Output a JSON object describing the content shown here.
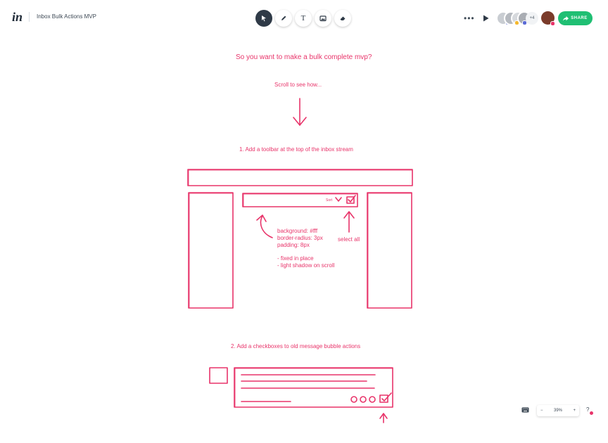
{
  "header": {
    "logo": "in",
    "title": "Inbox Bulk Actions MVP",
    "tools": [
      {
        "name": "select-tool",
        "icon": "cursor-icon",
        "active": true
      },
      {
        "name": "pen-tool",
        "icon": "pen-icon",
        "active": false
      },
      {
        "name": "text-tool",
        "icon": "text-icon",
        "label": "T",
        "active": false
      },
      {
        "name": "image-tool",
        "icon": "image-icon",
        "active": false
      },
      {
        "name": "eraser-tool",
        "icon": "eraser-icon",
        "active": false
      }
    ],
    "more_label": "•••",
    "collaborators_more": "+4",
    "share_label": "SHARE"
  },
  "canvas": {
    "heading": "So you want to make a bulk complete mvp?",
    "scroll_hint": "Scroll to see how...",
    "step1": "1. Add a toolbar at the top of the inbox stream",
    "sort_label": "Sort",
    "note_lines": [
      "background: #fff",
      "border-radius: 3px",
      "padding: 8px"
    ],
    "note_bullets": [
      "- fixed in place",
      "- light shadow on scroll"
    ],
    "select_all": "select all",
    "step2": "2. Add a checkboxes to old message bubble actions"
  },
  "footer": {
    "zoom": "39%",
    "zoom_out": "−",
    "zoom_in": "+",
    "help": "?"
  },
  "colors": {
    "sketch": "#e8346a",
    "share": "#1fbf73",
    "active_tool": "#2f3a47"
  }
}
